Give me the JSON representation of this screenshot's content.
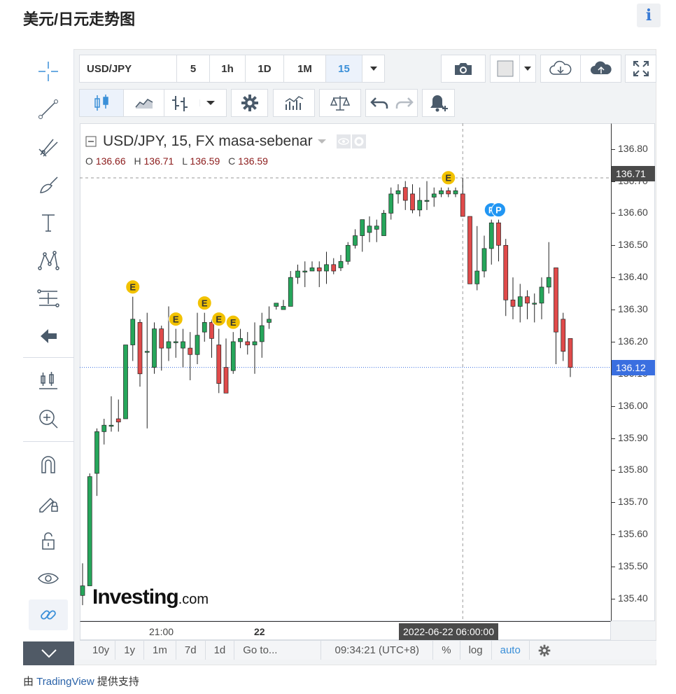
{
  "page": {
    "title": "美元/日元走势图",
    "info_icon": "info-icon"
  },
  "toolbar": {
    "symbol": "USD/JPY",
    "intervals": [
      "5",
      "1h",
      "1D",
      "1M",
      "15"
    ],
    "selected_interval": "15"
  },
  "legend": {
    "title": "USD/JPY, 15, FX masa-sebenar",
    "o_label": "O",
    "o": "136.66",
    "h_label": "H",
    "h": "136.71",
    "l_label": "L",
    "l": "136.59",
    "c_label": "C",
    "c": "136.59"
  },
  "price_axis": {
    "ticks": [
      "136.80",
      "136.70",
      "136.60",
      "136.50",
      "136.40",
      "136.30",
      "136.20",
      "136.10",
      "136.00",
      "135.90",
      "135.80",
      "135.70",
      "135.60",
      "135.50",
      "135.40"
    ],
    "crosshair_label": "136.71",
    "current_label": "136.12"
  },
  "time_axis": {
    "ticks": [
      "21:00",
      "22"
    ],
    "crosshair_label": "2022-06-22 06:00:00"
  },
  "bottom_bar": {
    "ranges": [
      "10y",
      "1y",
      "1m",
      "7d",
      "1d"
    ],
    "goto": "Go to...",
    "clock": "09:34:21 (UTC+8)",
    "percent": "%",
    "log": "log",
    "auto": "auto"
  },
  "logo": {
    "main": "Investing",
    "suffix": ".com"
  },
  "footer": {
    "prefix": "由 ",
    "link": "TradingView",
    "suffix": " 提供支持"
  },
  "colors": {
    "up": "#26a65b",
    "down": "#e04a4a",
    "accent": "#3a8fd8",
    "current_line": "#3a6fe0"
  },
  "chart_data": {
    "type": "candlestick",
    "ylim": [
      135.33,
      136.88
    ],
    "candles": [
      [
        135.41,
        135.44,
        135.51,
        135.38
      ],
      [
        135.44,
        135.78,
        135.79,
        135.44
      ],
      [
        135.79,
        135.92,
        135.93,
        135.72
      ],
      [
        135.92,
        135.94,
        135.96,
        135.88
      ],
      [
        135.94,
        135.94,
        136.03,
        135.92
      ],
      [
        135.96,
        135.95,
        136.02,
        135.92
      ],
      [
        135.96,
        136.19,
        136.19,
        135.96
      ],
      [
        136.19,
        136.27,
        136.34,
        136.14
      ],
      [
        136.26,
        136.1,
        136.27,
        136.06
      ],
      [
        136.17,
        136.17,
        136.29,
        135.93
      ],
      [
        136.12,
        136.24,
        136.26,
        136.1
      ],
      [
        136.24,
        136.18,
        136.25,
        136.11
      ],
      [
        136.18,
        136.2,
        136.31,
        136.14
      ],
      [
        136.2,
        136.2,
        136.24,
        136.15
      ],
      [
        136.18,
        136.2,
        136.24,
        136.12
      ],
      [
        136.18,
        136.16,
        136.23,
        136.08
      ],
      [
        136.16,
        136.22,
        136.29,
        136.13
      ],
      [
        136.23,
        136.26,
        136.29,
        136.2
      ],
      [
        136.26,
        136.21,
        136.27,
        136.15
      ],
      [
        136.19,
        136.07,
        136.24,
        136.04
      ],
      [
        136.12,
        136.04,
        136.21,
        136.04
      ],
      [
        136.11,
        136.2,
        136.23,
        136.1
      ],
      [
        136.2,
        136.21,
        136.24,
        136.18
      ],
      [
        136.2,
        136.19,
        136.23,
        136.16
      ],
      [
        136.19,
        136.2,
        136.26,
        136.1
      ],
      [
        136.2,
        136.25,
        136.29,
        136.15
      ],
      [
        136.26,
        136.27,
        136.31,
        136.24
      ],
      [
        136.31,
        136.32,
        136.32,
        136.3
      ],
      [
        136.3,
        136.31,
        136.33,
        136.3
      ],
      [
        136.31,
        136.4,
        136.42,
        136.31
      ],
      [
        136.4,
        136.42,
        136.44,
        136.38
      ],
      [
        136.42,
        136.42,
        136.45,
        136.37
      ],
      [
        136.42,
        136.43,
        136.45,
        136.42
      ],
      [
        136.43,
        136.42,
        136.45,
        136.37
      ],
      [
        136.42,
        136.44,
        136.48,
        136.38
      ],
      [
        136.44,
        136.42,
        136.46,
        136.41
      ],
      [
        136.43,
        136.45,
        136.47,
        136.42
      ],
      [
        136.45,
        136.5,
        136.51,
        136.44
      ],
      [
        136.5,
        136.53,
        136.55,
        136.49
      ],
      [
        136.53,
        136.58,
        136.58,
        136.48
      ],
      [
        136.54,
        136.56,
        136.59,
        136.51
      ],
      [
        136.55,
        136.56,
        136.58,
        136.51
      ],
      [
        136.53,
        136.6,
        136.61,
        136.53
      ],
      [
        136.6,
        136.66,
        136.68,
        136.58
      ],
      [
        136.66,
        136.67,
        136.69,
        136.63
      ],
      [
        136.68,
        136.64,
        136.7,
        136.61
      ],
      [
        136.66,
        136.61,
        136.69,
        136.6
      ],
      [
        136.61,
        136.64,
        136.68,
        136.59
      ],
      [
        136.64,
        136.64,
        136.7,
        136.61
      ],
      [
        136.65,
        136.66,
        136.68,
        136.62
      ],
      [
        136.66,
        136.67,
        136.68,
        136.65
      ],
      [
        136.67,
        136.66,
        136.68,
        136.65
      ],
      [
        136.66,
        136.67,
        136.68,
        136.65
      ],
      [
        136.66,
        136.59,
        136.71,
        136.59
      ],
      [
        136.59,
        136.38,
        136.59,
        136.38
      ],
      [
        136.38,
        136.42,
        136.56,
        136.36
      ],
      [
        136.42,
        136.49,
        136.53,
        136.4
      ],
      [
        136.49,
        136.57,
        136.58,
        136.44
      ],
      [
        136.57,
        136.5,
        136.58,
        136.45
      ],
      [
        136.5,
        136.33,
        136.52,
        136.28
      ],
      [
        136.33,
        136.31,
        136.4,
        136.27
      ],
      [
        136.31,
        136.34,
        136.38,
        136.26
      ],
      [
        136.34,
        136.32,
        136.36,
        136.27
      ],
      [
        136.32,
        136.32,
        136.35,
        136.26
      ],
      [
        136.32,
        136.37,
        136.4,
        136.27
      ],
      [
        136.37,
        136.4,
        136.51,
        136.35
      ],
      [
        136.43,
        136.23,
        136.43,
        136.13
      ],
      [
        136.27,
        136.17,
        136.29,
        136.14
      ],
      [
        136.21,
        136.12,
        136.21,
        136.09
      ]
    ],
    "event_markers": [
      {
        "label": "E",
        "i": 7
      },
      {
        "label": "E",
        "i": 13
      },
      {
        "label": "E",
        "i": 17
      },
      {
        "label": "E",
        "i": 19
      },
      {
        "label": "E",
        "i": 21
      },
      {
        "label": "E",
        "i": 51
      },
      {
        "label": "P",
        "i": 57
      },
      {
        "label": "P",
        "i": 58
      }
    ]
  }
}
